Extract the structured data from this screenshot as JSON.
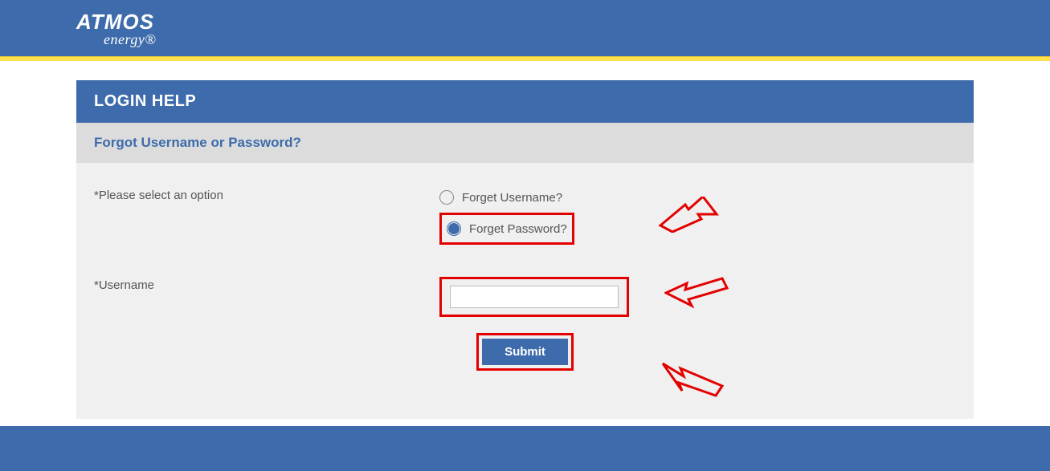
{
  "brand": {
    "line1": "ATMOS",
    "line2": "energy®"
  },
  "panel": {
    "title": "LOGIN HELP",
    "subtitle": "Forgot Username or Password?"
  },
  "form": {
    "option_label": "*Please select an option",
    "options": {
      "username": "Forget Username?",
      "password": "Forget Password?"
    },
    "username_label": "*Username",
    "username_value": "",
    "submit_label": "Submit"
  }
}
